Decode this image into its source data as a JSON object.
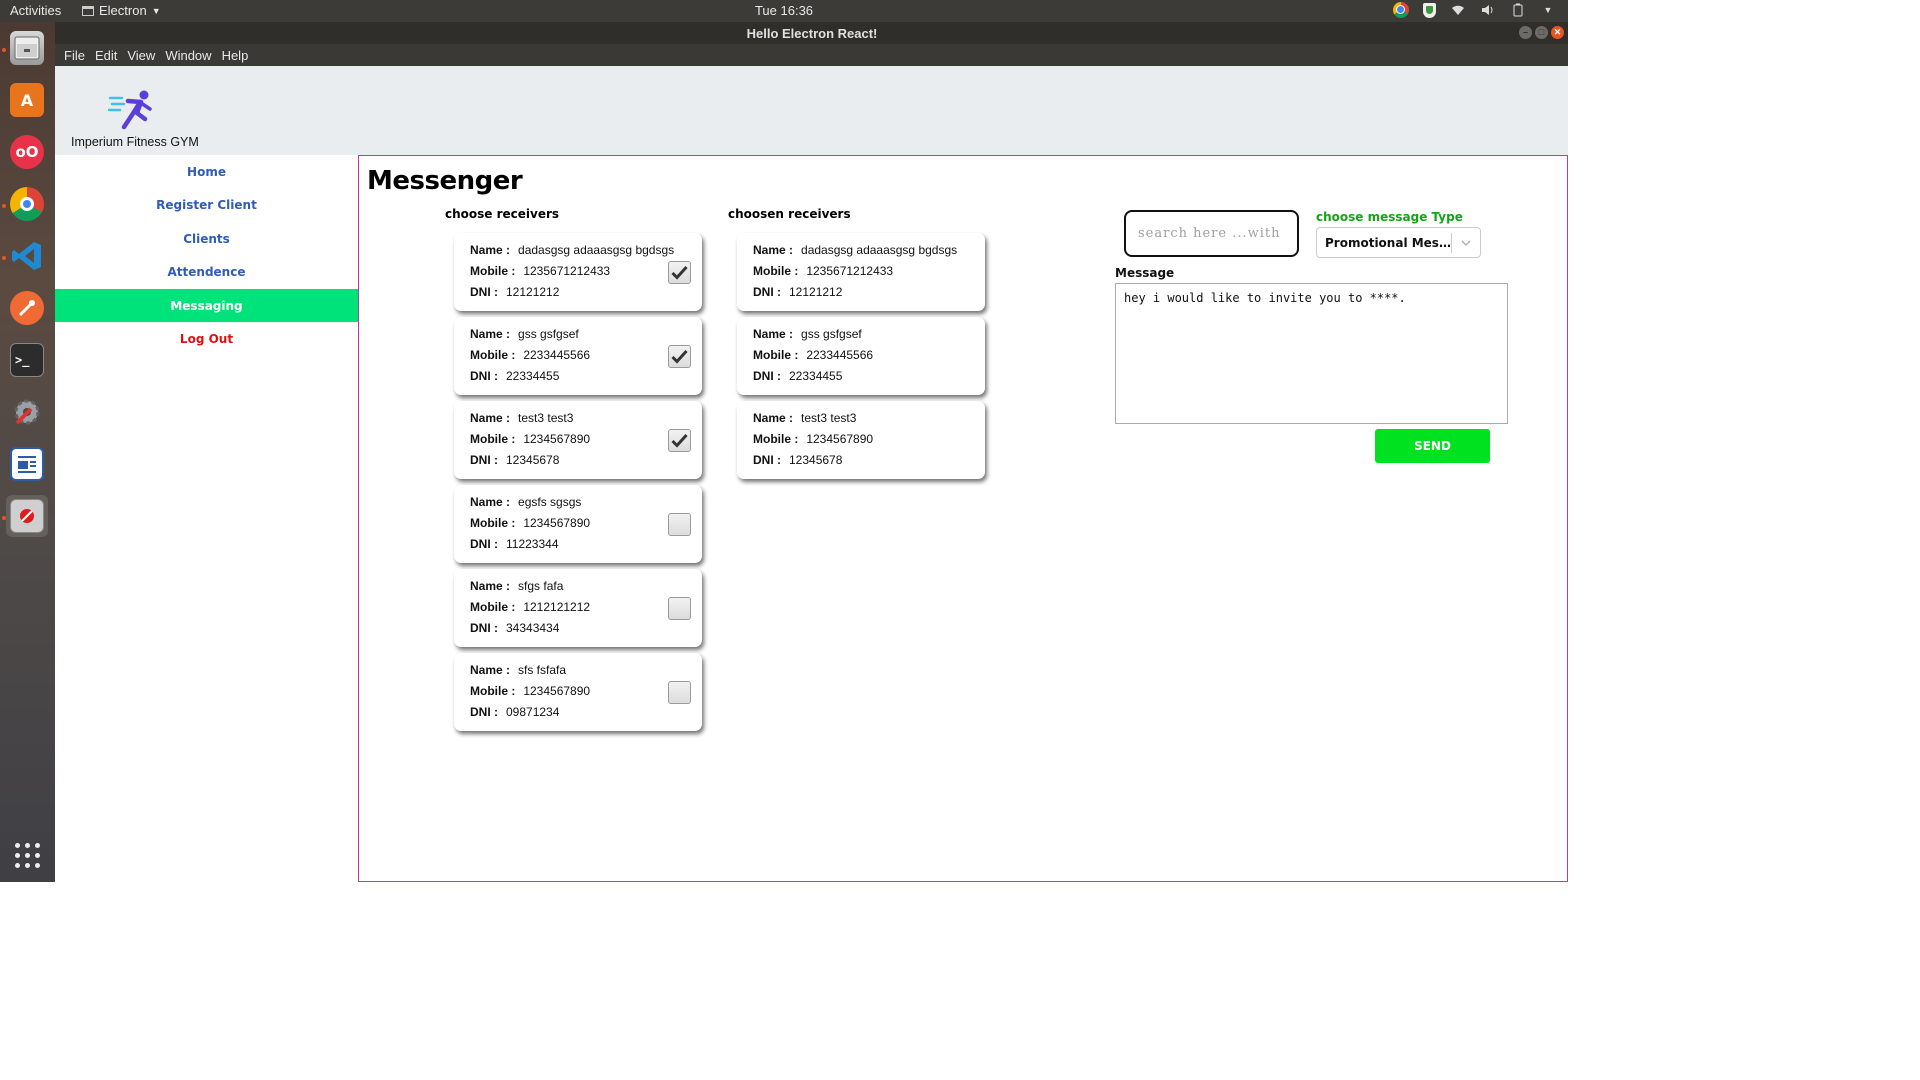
{
  "topbar": {
    "activities": "Activities",
    "app_name": "Electron",
    "clock": "Tue 16:36"
  },
  "window": {
    "title": "Hello Electron React!"
  },
  "menu": [
    "File",
    "Edit",
    "View",
    "Window",
    "Help"
  ],
  "dock": [
    "files",
    "software-center",
    "app-oo",
    "chrome",
    "vscode",
    "postman",
    "terminal",
    "settings",
    "writer",
    "electron",
    "show-apps"
  ],
  "brand": {
    "name": "Imperium Fitness GYM"
  },
  "nav": {
    "home": "Home",
    "register": "Register Client",
    "clients": "Clients",
    "attendance": "Attendence",
    "messaging": "Messaging",
    "logout": "Log Out"
  },
  "page": {
    "title": "Messenger",
    "choose_title": "choose receivers",
    "chosen_title": "choosen receivers"
  },
  "labels": {
    "name": "Name :",
    "mobile": "Mobile :",
    "dni": "DNI :"
  },
  "receivers": [
    {
      "name": "dadasgsg adaaasgsg bgdsgs",
      "mobile": "1235671212433",
      "dni": "12121212",
      "checked": true
    },
    {
      "name": "gss gsfgsef",
      "mobile": "2233445566",
      "dni": "22334455",
      "checked": true
    },
    {
      "name": "test3 test3",
      "mobile": "1234567890",
      "dni": "12345678",
      "checked": true
    },
    {
      "name": "egsfs sgsgs",
      "mobile": "1234567890",
      "dni": "11223344",
      "checked": false
    },
    {
      "name": "sfgs fafa",
      "mobile": "1212121212",
      "dni": "34343434",
      "checked": false
    },
    {
      "name": "sfs fsfafa",
      "mobile": "1234567890",
      "dni": "09871234",
      "checked": false
    }
  ],
  "chosen": [
    {
      "name": "dadasgsg adaaasgsg bgdsgs",
      "mobile": "1235671212433",
      "dni": "12121212"
    },
    {
      "name": "gss gsfgsef",
      "mobile": "2233445566",
      "dni": "22334455"
    },
    {
      "name": "test3 test3",
      "mobile": "1234567890",
      "dni": "12345678"
    }
  ],
  "search": {
    "placeholder": "search here ...with dni",
    "value": ""
  },
  "message_type": {
    "label": "choose message Type",
    "selected": "Promotional Message"
  },
  "message": {
    "label": "Message",
    "value": "hey i would like to invite you to ****."
  },
  "send_label": "SEND",
  "colors": {
    "accent": "#00e37a",
    "send": "#00e11f",
    "nav_text": "#2f5cb5",
    "logout": "#e01010",
    "main_border": "#b33ab3"
  }
}
